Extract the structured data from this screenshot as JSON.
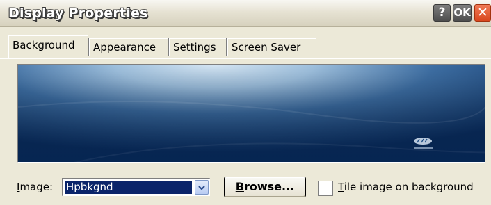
{
  "window": {
    "title": "Display Properties",
    "help_label": "?",
    "ok_label": "OK",
    "close_label": "✕"
  },
  "tabs": [
    {
      "label": "Background",
      "active": true
    },
    {
      "label": "Appearance",
      "active": false
    },
    {
      "label": "Settings",
      "active": false
    },
    {
      "label": "Screen Saver",
      "active": false
    }
  ],
  "image_field": {
    "label_accel": "I",
    "label_rest": "mage:",
    "value": "Hpbkgnd"
  },
  "browse_button": {
    "label_accel": "B",
    "label_rest": "rowse..."
  },
  "tile_checkbox": {
    "label_accel": "T",
    "label_rest": "ile image on background",
    "checked": false
  },
  "colors": {
    "selection": "#0a246a",
    "wallpaper_dark": "#0b3165",
    "wallpaper_light": "#c9ddee"
  }
}
